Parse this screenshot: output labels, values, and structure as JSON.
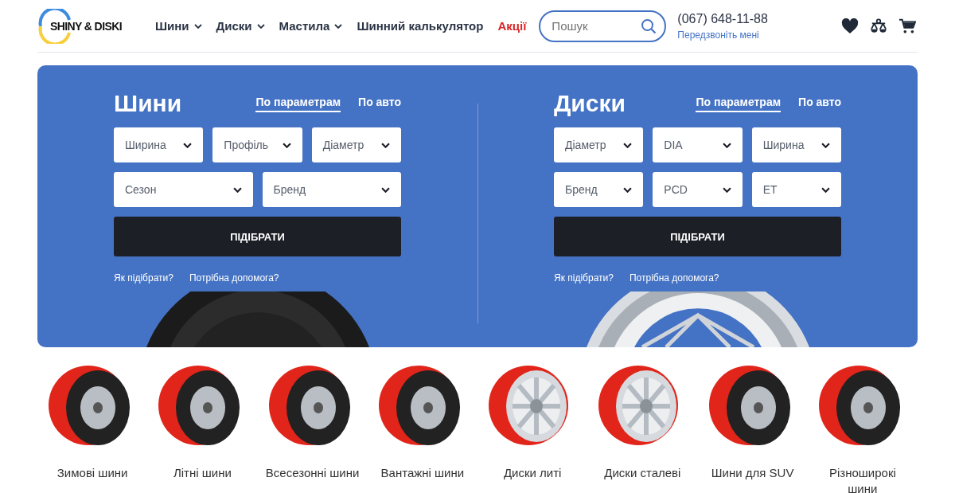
{
  "header": {
    "logo": "SHINY & DISKI",
    "nav": [
      {
        "label": "Шини",
        "dropdown": true,
        "highlight": false
      },
      {
        "label": "Диски",
        "dropdown": true,
        "highlight": false
      },
      {
        "label": "Мастила",
        "dropdown": true,
        "highlight": false
      },
      {
        "label": "Шинний калькулятор",
        "dropdown": false,
        "highlight": false
      },
      {
        "label": "Акції",
        "dropdown": false,
        "highlight": true
      }
    ],
    "search": {
      "placeholder": "Пошук"
    },
    "phone": "(067) 648-11-88",
    "callback": "Передзвоніть мені"
  },
  "panels": [
    {
      "title": "Шини",
      "kind": "tire",
      "tabs": [
        {
          "label": "По параметрам",
          "selected": true
        },
        {
          "label": "По авто",
          "selected": false
        }
      ],
      "rows": [
        [
          "Ширина",
          "Профіль",
          "Діаметр"
        ],
        [
          "Сезон",
          "Бренд"
        ]
      ],
      "button": "ПІДІБРАТИ",
      "links": [
        "Як підібрати?",
        "Потрібна допомога?"
      ]
    },
    {
      "title": "Диски",
      "kind": "rim",
      "tabs": [
        {
          "label": "По параметрам",
          "selected": true
        },
        {
          "label": "По авто",
          "selected": false
        }
      ],
      "rows": [
        [
          "Діаметр",
          "DIA",
          "Ширина"
        ],
        [
          "Бренд",
          "PCD",
          "ET"
        ]
      ],
      "button": "ПІДІБРАТИ",
      "links": [
        "Як підібрати?",
        "Потрібна допомога?"
      ]
    }
  ],
  "categories": [
    {
      "label": "Зимові шини",
      "kind": "tire"
    },
    {
      "label": "Літні шини",
      "kind": "tire"
    },
    {
      "label": "Всесезонні шини",
      "kind": "tire"
    },
    {
      "label": "Вантажні шини",
      "kind": "tire"
    },
    {
      "label": "Диски литі",
      "kind": "rim"
    },
    {
      "label": "Диски сталеві",
      "kind": "rim"
    },
    {
      "label": "Шини для SUV",
      "kind": "tire"
    },
    {
      "label": "Різноширокі шини",
      "kind": "tire"
    }
  ]
}
